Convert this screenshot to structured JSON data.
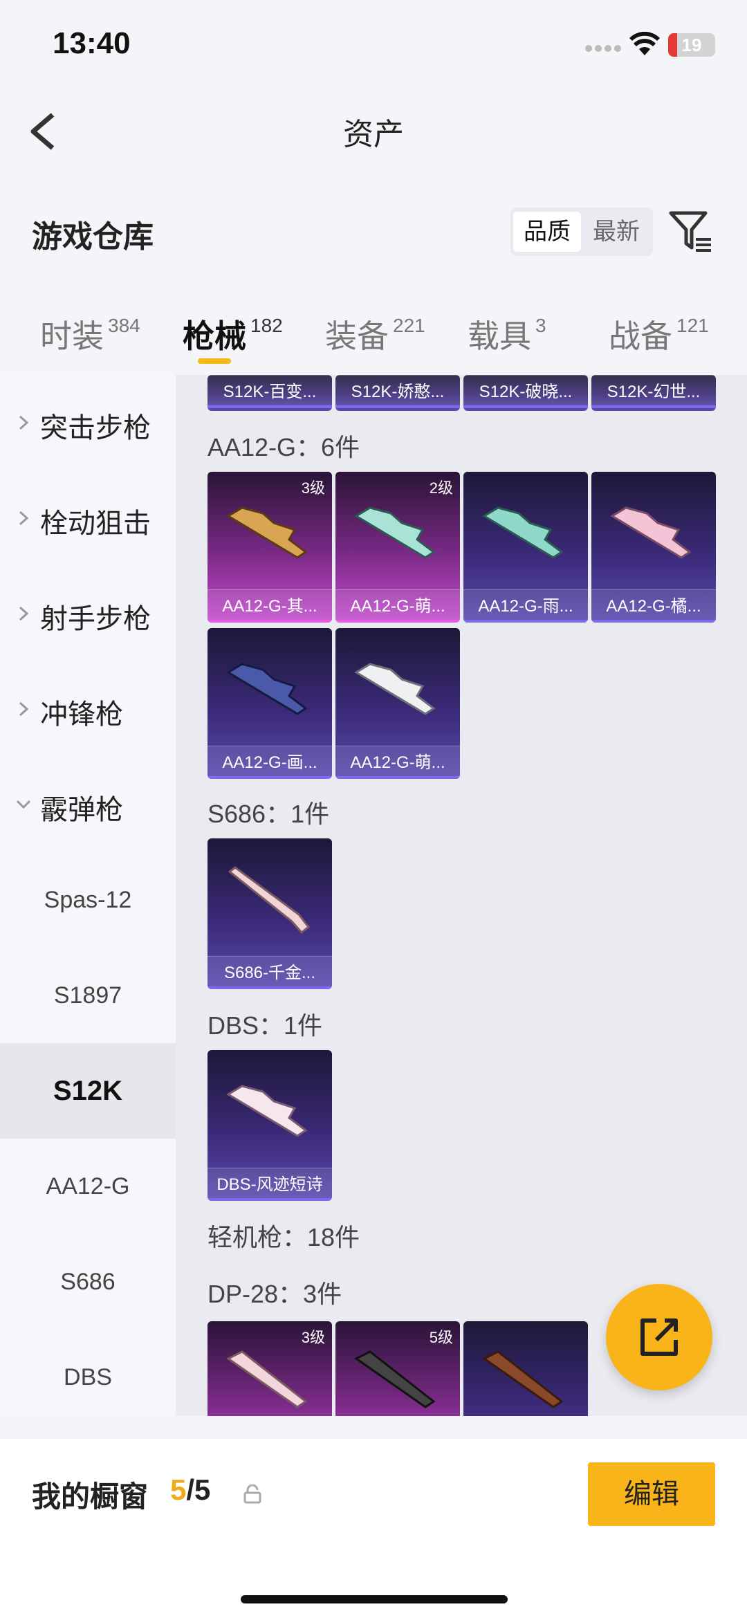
{
  "status_bar": {
    "time": "13:40",
    "battery": "19",
    "battery_fraction": 0.19
  },
  "nav": {
    "title": "资产"
  },
  "header": {
    "title": "游戏仓库",
    "sort_options": [
      "品质",
      "最新"
    ],
    "sort_selected": "品质"
  },
  "tabs": [
    {
      "label": "时装",
      "count": "384"
    },
    {
      "label": "枪械",
      "count": "182",
      "active": true
    },
    {
      "label": "装备",
      "count": "221"
    },
    {
      "label": "载具",
      "count": "3"
    },
    {
      "label": "战备",
      "count": "121"
    }
  ],
  "sidebar": {
    "categories": [
      {
        "label": "突击步枪",
        "expanded": false
      },
      {
        "label": "栓动狙击",
        "expanded": false
      },
      {
        "label": "射手步枪",
        "expanded": false
      },
      {
        "label": "冲锋枪",
        "expanded": false
      },
      {
        "label": "霰弹枪",
        "expanded": true
      }
    ],
    "subitems": [
      "Spas-12",
      "S1897",
      "S12K",
      "AA12-G",
      "S686",
      "DBS"
    ],
    "selected": "S12K"
  },
  "content": {
    "top_row": [
      "S12K-百变...",
      "S12K-娇憨...",
      "S12K-破晓...",
      "S12K-幻世..."
    ],
    "groups": [
      {
        "title": "AA12-G：6件",
        "items": [
          {
            "name": "AA12-G-其...",
            "level": "3级",
            "rarity": "pink"
          },
          {
            "name": "AA12-G-萌...",
            "level": "2级",
            "rarity": "pink"
          },
          {
            "name": "AA12-G-雨...",
            "level": "",
            "rarity": "purple"
          },
          {
            "name": "AA12-G-橘...",
            "level": "",
            "rarity": "purple"
          },
          {
            "name": "AA12-G-画...",
            "level": "",
            "rarity": "purple"
          },
          {
            "name": "AA12-G-萌...",
            "level": "",
            "rarity": "purple"
          }
        ]
      },
      {
        "title": "S686：1件",
        "items": [
          {
            "name": "S686-千金...",
            "level": "",
            "rarity": "purple"
          }
        ]
      },
      {
        "title": "DBS：1件",
        "items": [
          {
            "name": "DBS-风迹短诗",
            "level": "",
            "rarity": "purple"
          }
        ]
      },
      {
        "title": "轻机枪：18件",
        "items": []
      },
      {
        "title": "DP-28：3件",
        "items": [
          {
            "name": "",
            "level": "3级",
            "rarity": "pink"
          },
          {
            "name": "",
            "level": "5级",
            "rarity": "pink"
          },
          {
            "name": "",
            "level": "",
            "rarity": "purple"
          }
        ]
      }
    ]
  },
  "bottom": {
    "window_label": "我的橱窗",
    "window_current": "5",
    "window_total": "/5",
    "edit_label": "编辑"
  },
  "colors": {
    "accent": "#f9b419",
    "pink_card": "#c44fcf",
    "purple_card": "#5a4bb0"
  },
  "icons": [
    "back-icon",
    "filter-icon",
    "chevron-right-icon",
    "chevron-down-icon",
    "share-icon",
    "lock-icon",
    "wifi-icon",
    "battery-icon"
  ]
}
